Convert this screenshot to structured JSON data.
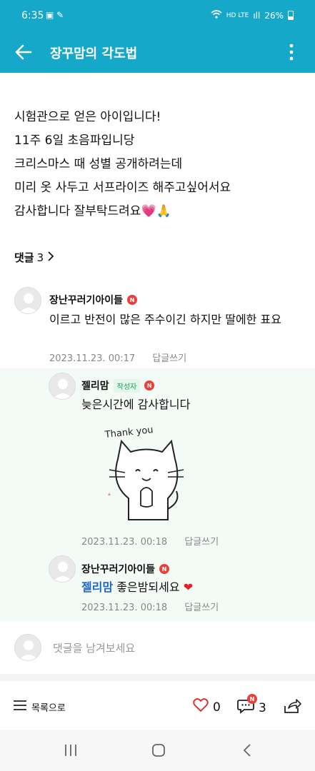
{
  "status_bar": {
    "time": "6:35",
    "left_icons": "▣ ✎",
    "network": "HD LTE",
    "signal": "ıll",
    "battery": "26%"
  },
  "app_bar": {
    "title": "장꾸맘의 각도법"
  },
  "post": {
    "lines": [
      "시험관으로 얻은 아이입니다!",
      "11주 6일 초음파입니당",
      "크리스마스 때 성별 공개하려는데",
      "미리 옷 사두고 서프라이즈 해주고싶어서요",
      "감사합니다 잘부탁드려요💗🙏"
    ]
  },
  "comments_header": {
    "label": "댓글",
    "count": "3",
    "chevron": "›"
  },
  "comments": [
    {
      "author": "장난꾸러기아이들",
      "badge": "N",
      "text": "이르고 반전이 많은 주수이긴 하지만 딸에한 표요",
      "date": "2023.11.23. 00:17",
      "reply": "답글쓰기"
    },
    {
      "author": "젤리맘",
      "author_badge": "작성자",
      "badge": "N",
      "text": "늦은시간에 감사합니다",
      "sticker_text": "Thank you",
      "date": "2023.11.23. 00:18",
      "reply": "답글쓰기"
    },
    {
      "author": "장난꾸러기아이들",
      "badge": "N",
      "mention": "젤리맘",
      "text": "좋은밤되세요",
      "emoji": "❤",
      "date": "2023.11.23. 00:18",
      "reply": "답글쓰기"
    }
  ],
  "compose": {
    "placeholder": "댓글을 남겨보세요"
  },
  "bottom_bar": {
    "list_label": "목록으로",
    "likes": "0",
    "comments": "3",
    "comment_badge": "N"
  },
  "colors": {
    "brand": "#16a8c8",
    "badge_red": "#e8413c",
    "mention_blue": "#1a66c9",
    "author_green": "#1aa058"
  },
  "icons": [
    "back-arrow-icon",
    "more-vert-icon",
    "chevron-right-icon",
    "avatar-placeholder-icon",
    "menu-list-icon",
    "heart-icon",
    "comment-bubble-icon",
    "share-icon",
    "recents-icon",
    "home-icon",
    "back-nav-icon"
  ]
}
